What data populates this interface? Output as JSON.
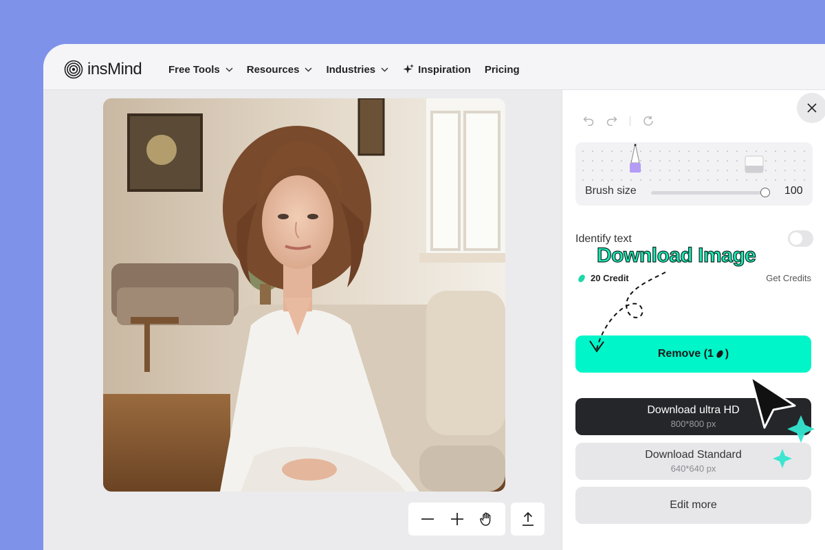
{
  "brand": {
    "name": "insMind"
  },
  "nav": {
    "items": [
      {
        "label": "Free Tools",
        "dropdown": true,
        "icon": "chevron-down-icon"
      },
      {
        "label": "Resources",
        "dropdown": true,
        "icon": "chevron-down-icon"
      },
      {
        "label": "Industries",
        "dropdown": true,
        "icon": "chevron-down-icon"
      },
      {
        "label": "Inspiration",
        "dropdown": false,
        "icon": "sparkle-icon"
      },
      {
        "label": "Pricing",
        "dropdown": false
      }
    ]
  },
  "canvas": {
    "photo_description_icon": "portrait-photo",
    "toolbar": [
      "zoom-out-icon",
      "zoom-in-icon",
      "hand-icon"
    ],
    "upload_icon": "upload-icon"
  },
  "panel": {
    "history": [
      "undo-icon",
      "redo-icon",
      "reset-icon"
    ],
    "brush": {
      "label": "Brush size",
      "value": "100",
      "level": 1.0
    },
    "identify_text": {
      "label": "Identify text",
      "enabled": false
    },
    "callout": "Download Image",
    "credits": {
      "amount": "20 Credit",
      "link": "Get Credits"
    },
    "remove": {
      "label": "Remove (1",
      "suffix": ")"
    },
    "download_hd": {
      "label": "Download ultra HD",
      "size": "800*800 px"
    },
    "download_standard": {
      "label": "Download Standard",
      "size": "640*640 px"
    },
    "edit_more": {
      "label": "Edit more"
    }
  },
  "colors": {
    "background": "#7f92ea",
    "accent": "#00f5c8",
    "dark_button": "#25262a",
    "callout": "#1de9b6"
  }
}
